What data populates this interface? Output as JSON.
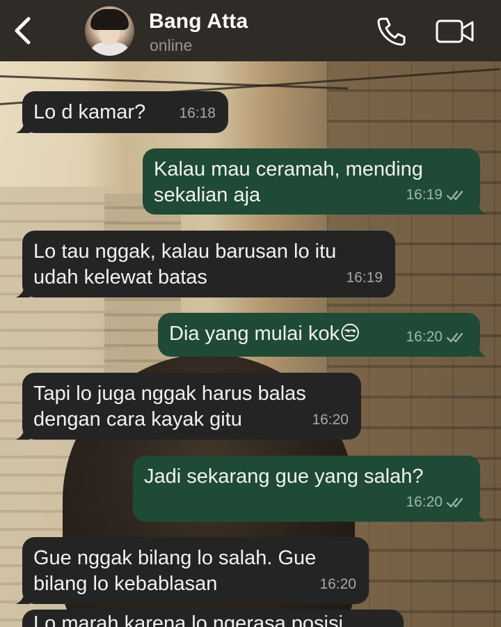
{
  "header": {
    "contact_name": "Bang Atta",
    "status": "online",
    "icons": [
      "chevron-left-icon",
      "phone-icon",
      "video-camera-icon"
    ]
  },
  "colors": {
    "header_bg": "#2f2b26",
    "incoming_bubble": "#242424",
    "outgoing_bubble": "#1f4a36",
    "text": "#f2f2f2",
    "timestamp": "#a8a8a8"
  },
  "messages": [
    {
      "direction": "in",
      "text": "Lo d kamar?",
      "time": "16:18"
    },
    {
      "direction": "out",
      "text": "Kalau mau ceramah, mending\nsekalian aja",
      "time": "16:19",
      "read": true
    },
    {
      "direction": "in",
      "text": "Lo tau nggak, kalau barusan lo itu\nudah kelewat batas",
      "time": "16:19"
    },
    {
      "direction": "out",
      "text": "Dia yang mulai kok😒",
      "time": "16:20",
      "read": true
    },
    {
      "direction": "in",
      "text": "Tapi lo juga nggak harus balas\ndengan cara kayak gitu",
      "time": "16:20"
    },
    {
      "direction": "out",
      "text": "Jadi sekarang gue yang salah?",
      "time": "16:20",
      "read": true
    },
    {
      "direction": "in",
      "text": "Gue nggak bilang lo salah. Gue\nbilang lo kebablasan",
      "time": "16:20"
    },
    {
      "direction": "in",
      "text": "Lo marah karena lo ngerasa posisi",
      "time": ""
    }
  ]
}
